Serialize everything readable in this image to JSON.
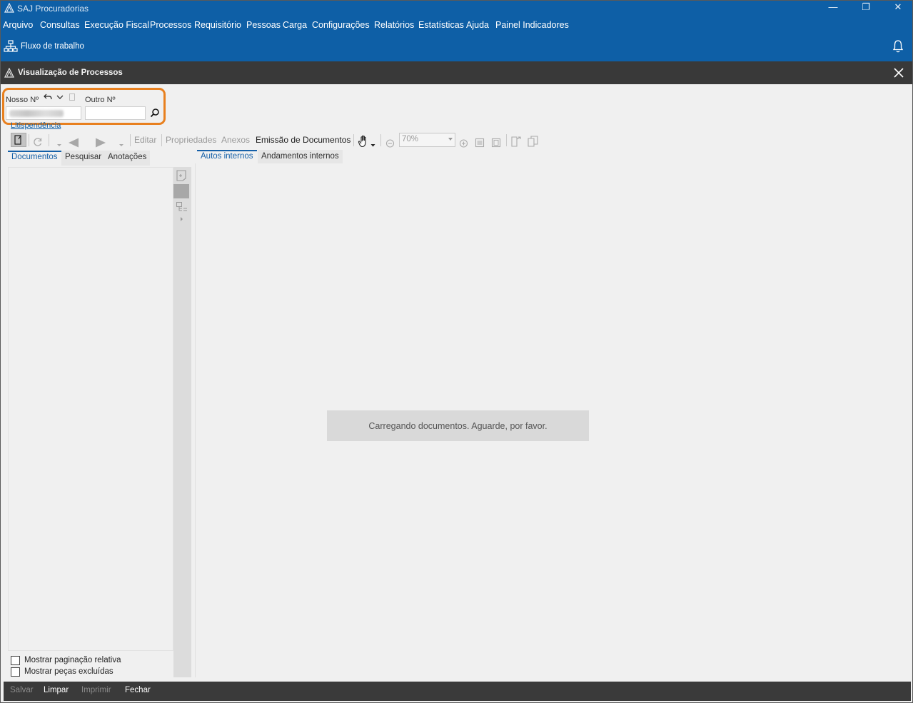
{
  "titlebar": {
    "title": "SAJ Procuradorias",
    "minimize_symbol": "—",
    "maximize_symbol": "❐",
    "close_symbol": "✕"
  },
  "menu": [
    {
      "label": "Arquivo"
    },
    {
      "label": "Consultas"
    },
    {
      "label": "Execução Fiscal"
    },
    {
      "label": "Processos"
    },
    {
      "label": "Requisitório"
    },
    {
      "label": "Pessoas"
    },
    {
      "label": "Carga"
    },
    {
      "label": "Configurações"
    },
    {
      "label": "Relatórios"
    },
    {
      "label": "Estatísticas"
    },
    {
      "label": "Ajuda"
    },
    {
      "label": "Painel Indicadores"
    }
  ],
  "workflow": {
    "label": "Fluxo de trabalho",
    "icon": "workflow-icon"
  },
  "window": {
    "title": "Visualização de Processos"
  },
  "search": {
    "nosso_label": "Nosso Nº",
    "outro_label": "Outro Nº",
    "nosso_value": "",
    "outro_value": "",
    "litispendencia_link": "Litispendência"
  },
  "toolbar": {
    "editar": "Editar",
    "propriedades": "Propriedades",
    "anexos": "Anexos",
    "emissao": "Emissão de Documentos",
    "zoom_value": "70%"
  },
  "left_tabs": [
    "Documentos",
    "Pesquisar",
    "Anotações"
  ],
  "right_tabs": [
    "Autos internos",
    "Andamentos internos"
  ],
  "checks": {
    "paginacao": "Mostrar paginação relativa",
    "excluidas": "Mostrar peças excluídas"
  },
  "loading_message": "Carregando documentos. Aguarde, por favor.",
  "bottom": {
    "salvar": "Salvar",
    "limpar": "Limpar",
    "imprimir": "Imprimir",
    "fechar": "Fechar"
  },
  "colors": {
    "header_blue": "#0e5fa6",
    "dark_header": "#393939",
    "highlight_orange": "#e8801f",
    "active_tab_blue": "#1560a8"
  }
}
